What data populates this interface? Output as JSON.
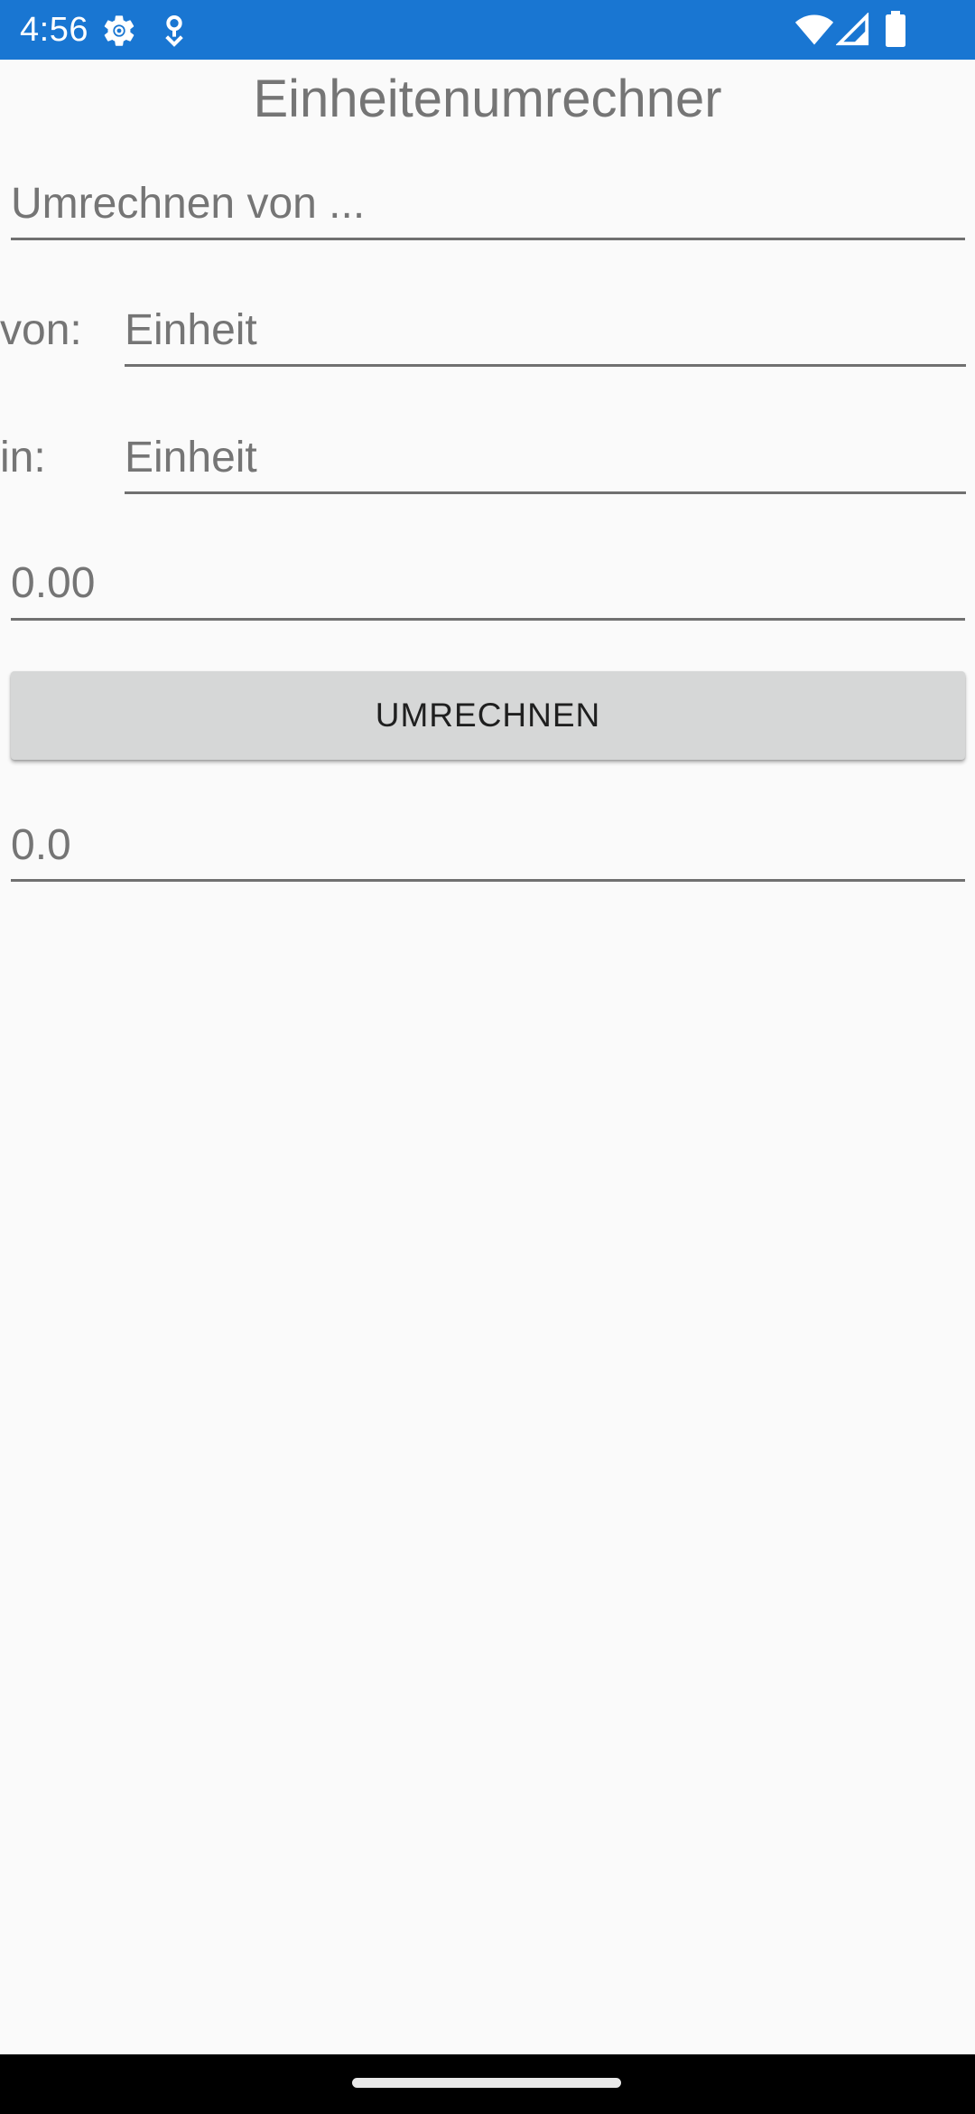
{
  "status_bar": {
    "time": "4:56",
    "background_color": "#1976d2",
    "icons": [
      "settings-gear-icon",
      "location-icon",
      "wifi-icon",
      "cell-signal-icon",
      "battery-icon"
    ]
  },
  "app": {
    "title": "Einheitenumrechner"
  },
  "form": {
    "value_input": {
      "placeholder": "Umrechnen von ..."
    },
    "from_row": {
      "label": "von:",
      "unit_placeholder": "Einheit"
    },
    "to_row": {
      "label": "in:",
      "unit_placeholder": "Einheit"
    },
    "amount": "0.00",
    "convert_button_label": "UMRECHNEN",
    "result": "0.0"
  }
}
